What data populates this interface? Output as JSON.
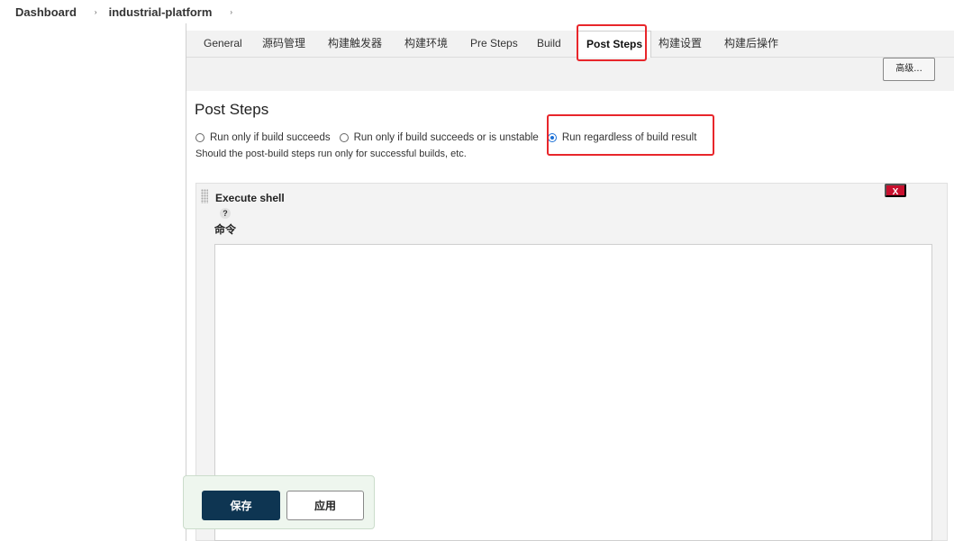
{
  "breadcrumb": {
    "items": [
      "Dashboard",
      "industrial-platform"
    ],
    "separator": "›"
  },
  "tabs": [
    {
      "label": "General",
      "active": false
    },
    {
      "label": "源码管理",
      "active": false
    },
    {
      "label": "构建触发器",
      "active": false
    },
    {
      "label": "构建环境",
      "active": false
    },
    {
      "label": "Pre Steps",
      "active": false
    },
    {
      "label": "Build",
      "active": false
    },
    {
      "label": "Post Steps",
      "active": true
    },
    {
      "label": "构建设置",
      "active": false
    },
    {
      "label": "构建后操作",
      "active": false
    }
  ],
  "advanced_button": "高级...",
  "post_steps": {
    "title": "Post Steps",
    "options": [
      {
        "label": "Run only if build succeeds",
        "checked": false
      },
      {
        "label": "Run only if build succeeds or is unstable",
        "checked": false
      },
      {
        "label": "Run regardless of build result",
        "checked": true
      }
    ],
    "help_text": "Should the post-build steps run only for successful builds, etc."
  },
  "build_step": {
    "title": "Execute shell",
    "help_icon": "?",
    "delete_label": "X",
    "command_label": "命令",
    "command_value": ""
  },
  "actions": {
    "save_label": "保存",
    "apply_label": "应用"
  },
  "colors": {
    "highlight": "#e8262b",
    "save_button": "#0e3552",
    "delete_button": "#c8102e",
    "radio_checked": "#1a6fd6"
  }
}
